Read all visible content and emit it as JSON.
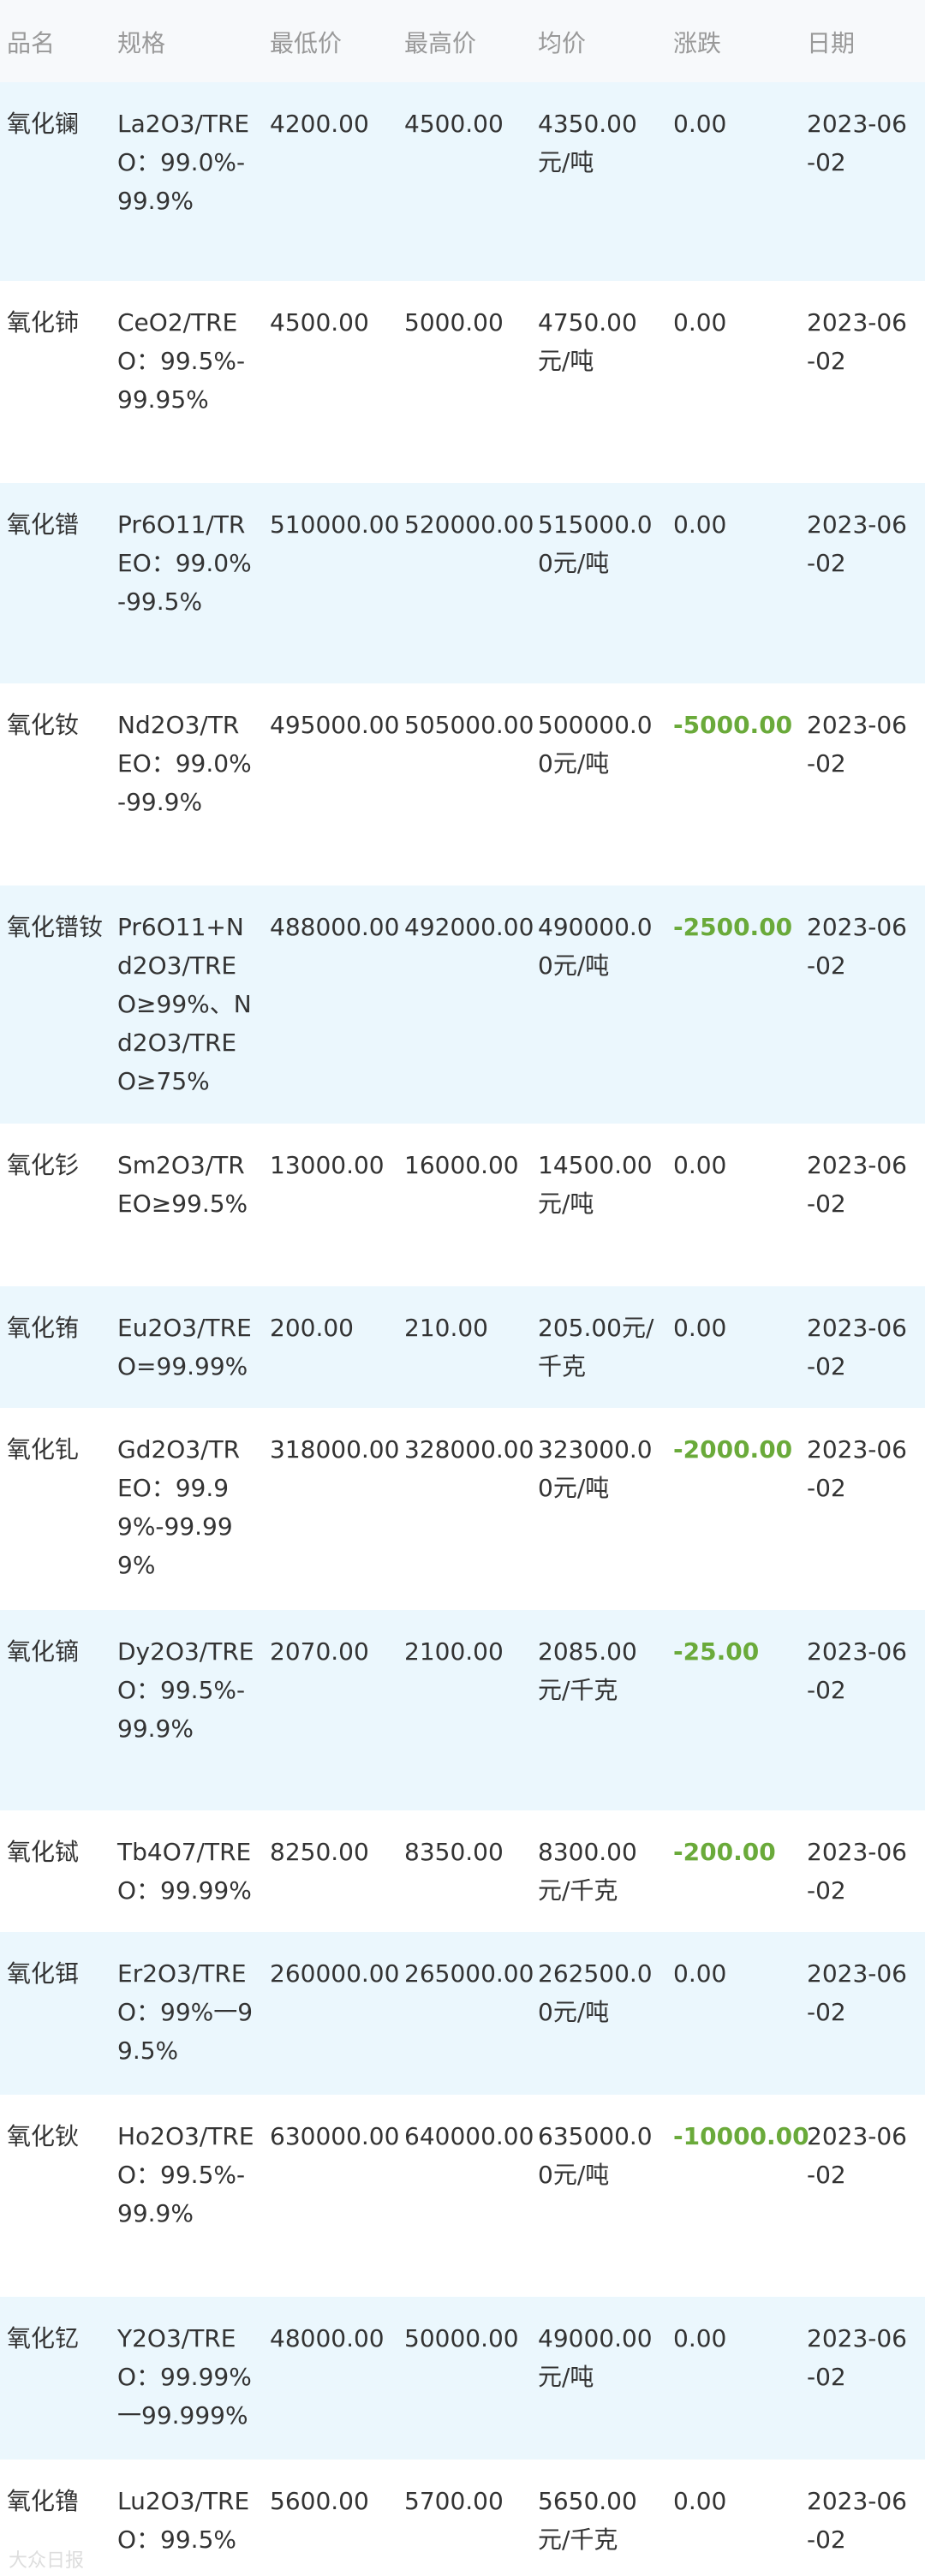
{
  "header": {
    "name": "品名",
    "spec": "规格",
    "low": "最低价",
    "high": "最高价",
    "avg": "均价",
    "change": "涨跌",
    "date": "日期"
  },
  "rows": [
    {
      "name": "氧化镧",
      "spec": "La2O3/TREO：99.0%-99.9%",
      "low": "4200.00",
      "high": "4500.00",
      "avg": "4350.00元/吨",
      "change": "0.00",
      "date": "2023-06-02"
    },
    {
      "name": "氧化铈",
      "spec": "CeO2/TREO：99.5%-99.95%",
      "low": "4500.00",
      "high": "5000.00",
      "avg": "4750.00元/吨",
      "change": "0.00",
      "date": "2023-06-02"
    },
    {
      "name": "氧化镨",
      "spec": "Pr6O11/TREO：99.0%-99.5%",
      "low": "510000.00",
      "high": "520000.00",
      "avg": "515000.00元/吨",
      "change": "0.00",
      "date": "2023-06-02"
    },
    {
      "name": "氧化钕",
      "spec": "Nd2O3/TREO：99.0%-99.9%",
      "low": "495000.00",
      "high": "505000.00",
      "avg": "500000.00元/吨",
      "change": "-5000.00",
      "date": "2023-06-02"
    },
    {
      "name": "氧化镨钕",
      "spec": "Pr6O11+Nd2O3/TREO≥99%、Nd2O3/TREO≥75%",
      "low": "488000.00",
      "high": "492000.00",
      "avg": "490000.00元/吨",
      "change": "-2500.00",
      "date": "2023-06-02"
    },
    {
      "name": "氧化钐",
      "spec": "Sm2O3/TREO≥99.5%",
      "low": "13000.00",
      "high": "16000.00",
      "avg": "14500.00元/吨",
      "change": "0.00",
      "date": "2023-06-02"
    },
    {
      "name": "氧化铕",
      "spec": "Eu2O3/TREO=99.99%",
      "low": "200.00",
      "high": "210.00",
      "avg": "205.00元/千克",
      "change": "0.00",
      "date": "2023-06-02"
    },
    {
      "name": "氧化钆",
      "spec": "Gd2O3/TREO：99.99%-99.999%",
      "low": "318000.00",
      "high": "328000.00",
      "avg": "323000.00元/吨",
      "change": "-2000.00",
      "date": "2023-06-02"
    },
    {
      "name": "氧化镝",
      "spec": "Dy2O3/TREO：99.5%-99.9%",
      "low": "2070.00",
      "high": "2100.00",
      "avg": "2085.00元/千克",
      "change": "-25.00",
      "date": "2023-06-02"
    },
    {
      "name": "氧化铽",
      "spec": "Tb4O7/TREO：99.99%",
      "low": "8250.00",
      "high": "8350.00",
      "avg": "8300.00元/千克",
      "change": "-200.00",
      "date": "2023-06-02"
    },
    {
      "name": "氧化铒",
      "spec": "Er2O3/TREO：99%一99.5%",
      "low": "260000.00",
      "high": "265000.00",
      "avg": "262500.00元/吨",
      "change": "0.00",
      "date": "2023-06-02"
    },
    {
      "name": "氧化钬",
      "spec": "Ho2O3/TREO：99.5%-99.9%",
      "low": "630000.00",
      "high": "640000.00",
      "avg": "635000.00元/吨",
      "change": "-10000.00",
      "date": "2023-06-02"
    },
    {
      "name": "氧化钇",
      "spec": "Y2O3/TREO：99.99%一99.999%",
      "low": "48000.00",
      "high": "50000.00",
      "avg": "49000.00元/吨",
      "change": "0.00",
      "date": "2023-06-02"
    },
    {
      "name": "氧化镥",
      "spec": "Lu2O3/TREO：99.5%",
      "low": "5600.00",
      "high": "5700.00",
      "avg": "5650.00元/千克",
      "change": "0.00",
      "date": "2023-06-02"
    }
  ],
  "colors": {
    "row_alt_bg": "#ebf7fd",
    "header_bg": "#f7f9fb",
    "negative_change": "#6aaa3a"
  },
  "watermark": "大众日报"
}
